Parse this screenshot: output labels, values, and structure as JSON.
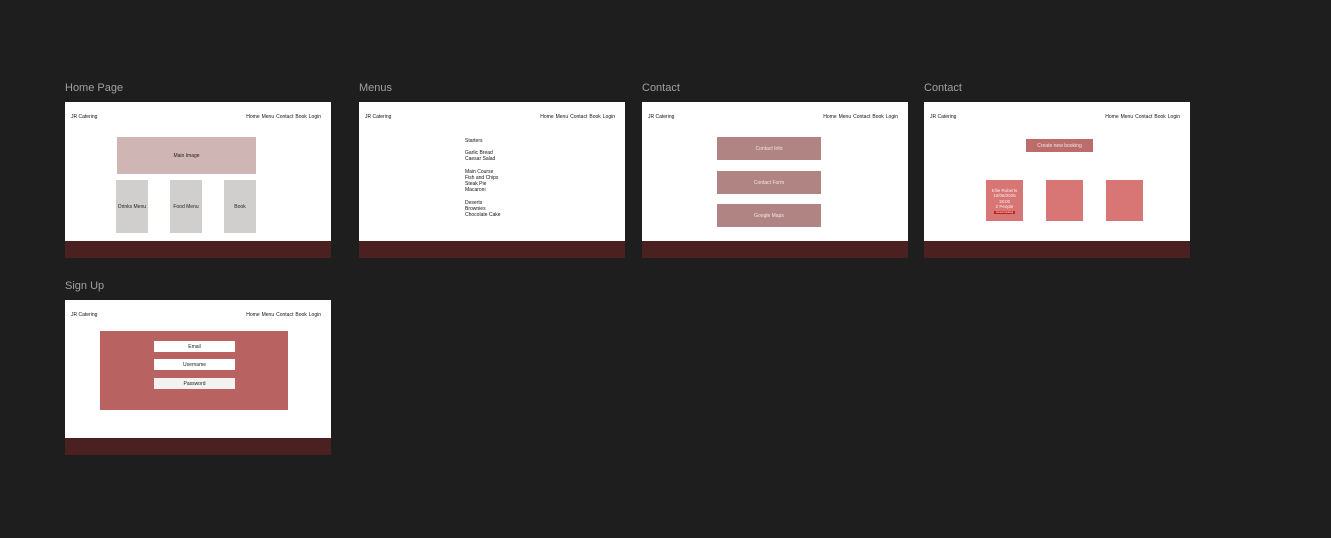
{
  "canvas": {
    "background": "#1e1e1e"
  },
  "common": {
    "brand": "JR Catering",
    "nav": [
      "Home",
      "Menu",
      "Contact",
      "Book",
      "Login"
    ],
    "footer_color": "#4a2020"
  },
  "frames": {
    "home": {
      "label": "Home Page",
      "main_image": "Main Image",
      "tiles": [
        "Drinks Menu",
        "Food Menu",
        "Book"
      ]
    },
    "menus": {
      "label": "Menus",
      "starters": [
        "Starters",
        "Garlic Bread",
        "Caesar Salad"
      ],
      "main_course": [
        "Main Course",
        "Fish and Chips",
        "Steak Pie",
        "Macaroni"
      ],
      "deserts": [
        "Deserts",
        "Brownies",
        "Chocolate Cake"
      ]
    },
    "contact": {
      "label": "Contact",
      "buttons": [
        "Contact Info",
        "Contact Form",
        "Google Maps"
      ]
    },
    "booking": {
      "label": "Contact",
      "create_button": "Create new booking",
      "card": {
        "name": "Ellie Roberts",
        "date": "10/06/2025",
        "time": "18:00",
        "people": "2 People",
        "cancel": "Cancel booking"
      }
    },
    "signup": {
      "label": "Sign Up",
      "fields": [
        "Email",
        "Username",
        "Password"
      ]
    }
  }
}
